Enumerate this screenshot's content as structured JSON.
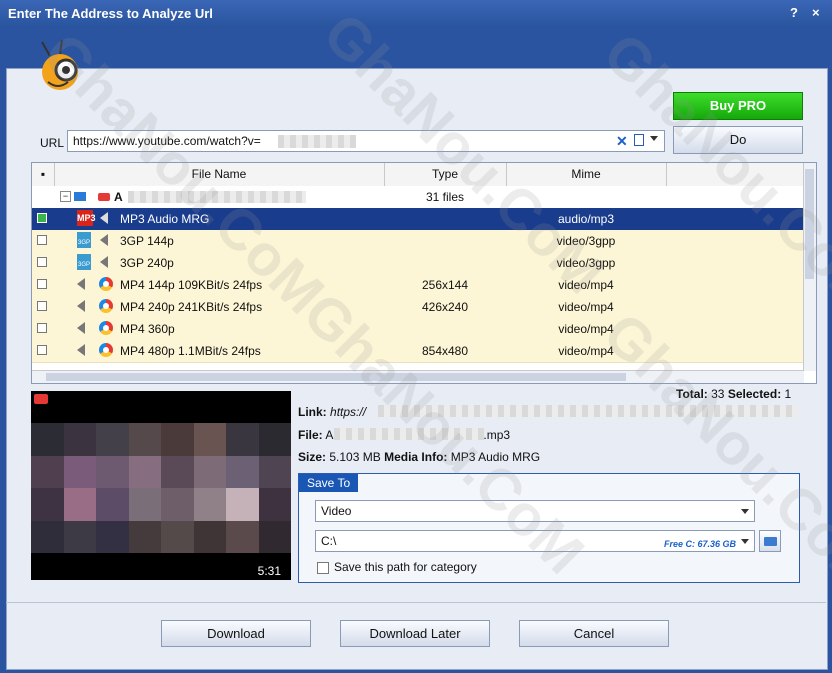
{
  "window": {
    "title": "Enter The Address to Analyze Url",
    "help_label": "?",
    "close_label": "×"
  },
  "toolbar": {
    "buy_label": "Buy PRO",
    "do_label": "Do"
  },
  "url": {
    "label": "URL",
    "value": "https://www.youtube.com/watch?v="
  },
  "grid": {
    "headers": [
      "File Name",
      "Type",
      "Mime"
    ],
    "parent": {
      "name": "A",
      "type": "31 files"
    },
    "rows": [
      {
        "name": "MP3 Audio MRG",
        "type": "",
        "mime": "audio/mp3",
        "icon": "mp3-icon",
        "selected": true
      },
      {
        "name": "3GP 144p",
        "type": "",
        "mime": "video/3gpp",
        "icon": "3gp-icon",
        "selected": false
      },
      {
        "name": "3GP 240p",
        "type": "",
        "mime": "video/3gpp",
        "icon": "3gp-icon",
        "selected": false
      },
      {
        "name": "MP4 144p 109KBit/s 24fps",
        "type": "256x144",
        "mime": "video/mp4",
        "icon": "mp4-icon",
        "selected": false
      },
      {
        "name": "MP4 240p 241KBit/s 24fps",
        "type": "426x240",
        "mime": "video/mp4",
        "icon": "mp4-icon",
        "selected": false
      },
      {
        "name": "MP4 360p",
        "type": "",
        "mime": "video/mp4",
        "icon": "mp4-icon",
        "selected": false
      },
      {
        "name": "MP4 480p 1.1MBit/s 24fps",
        "type": "854x480",
        "mime": "video/mp4",
        "icon": "mp4-icon",
        "selected": false
      }
    ]
  },
  "totals": {
    "total_label": "Total:",
    "total": "33",
    "selected_label": "Selected:",
    "selected": "1"
  },
  "preview": {
    "duration": "5:31"
  },
  "info": {
    "link_label": "Link:",
    "link_value": "https://",
    "file_label": "File:",
    "file_value": "A",
    "file_ext": ".mp3",
    "size_label": "Size:",
    "size_value": "5.103 MB",
    "media_label": "Media Info:",
    "media_value": "MP3 Audio MRG"
  },
  "save_to": {
    "title": "Save To",
    "category": "Video",
    "path": "C:\\",
    "free": "Free C: 67.36 GB",
    "save_path_label": "Save this path for category"
  },
  "buttons": {
    "download": "Download",
    "download_later": "Download Later",
    "cancel": "Cancel"
  },
  "watermark": "GhaNou.CoM"
}
